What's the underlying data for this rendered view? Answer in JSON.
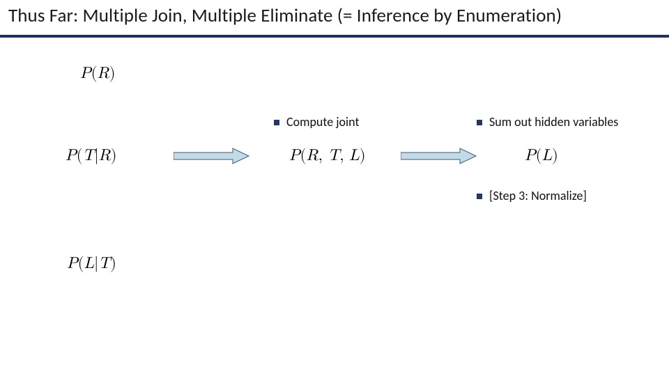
{
  "title": "Thus Far: Multiple Join, Multiple Eliminate (= Inference by Enumeration)",
  "bullets": {
    "compute_joint": "Compute joint",
    "sum_out": "Sum out hidden variables",
    "step3": "[Step 3: Normalize]"
  },
  "formulas": {
    "p_r": "P(R)",
    "p_t_given_r": "P(T|R)",
    "p_l_given_t": "P(L|T)",
    "p_rtl": "P(R, T, L)",
    "p_l": "P(L)"
  },
  "arrow": {
    "fill": "#c3dbe7",
    "stroke": "#3a5a7a"
  }
}
